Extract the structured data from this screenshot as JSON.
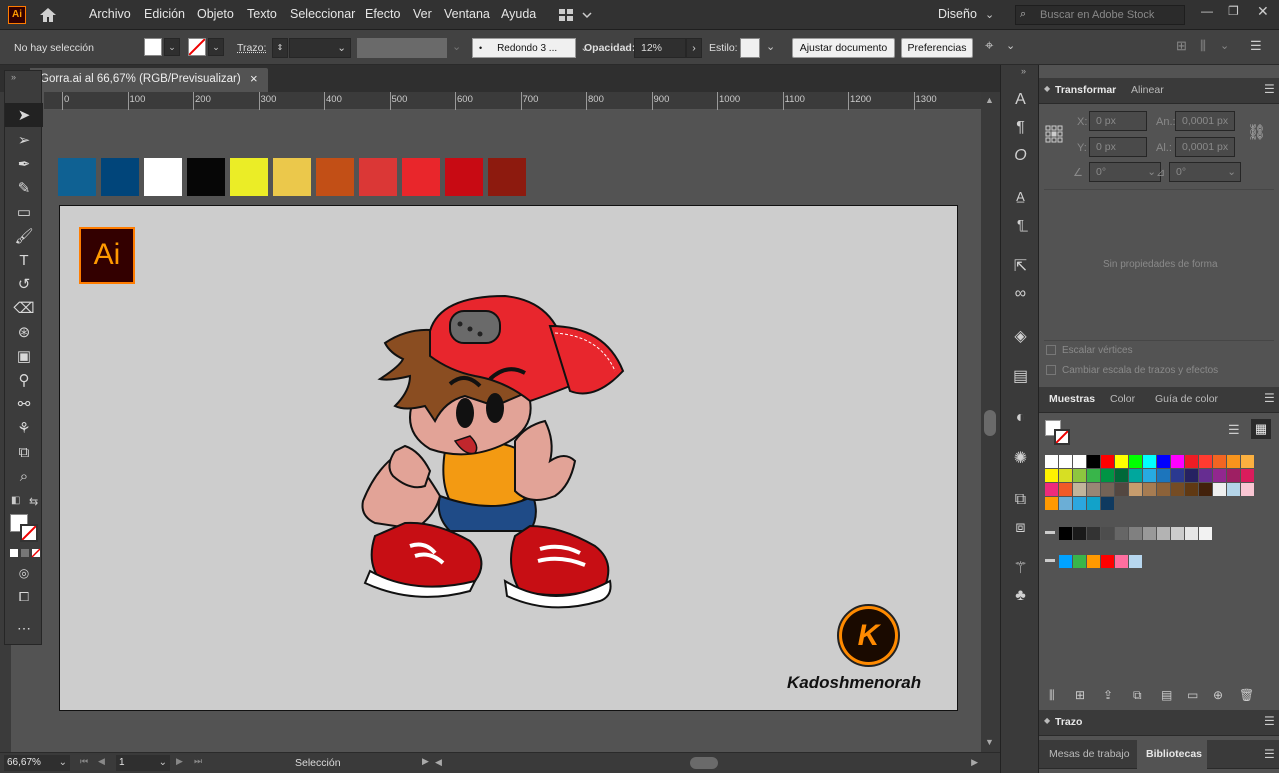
{
  "app": {
    "logo": "Ai"
  },
  "menu": {
    "items": [
      "Archivo",
      "Edición",
      "Objeto",
      "Texto",
      "Seleccionar",
      "Efecto",
      "Ver",
      "Ventana",
      "Ayuda"
    ],
    "workspace": "Diseño",
    "search_placeholder": "Buscar en Adobe Stock"
  },
  "control": {
    "selection": "No hay selección",
    "stroke_label": "Trazo:",
    "brush": "Redondo 3 ...",
    "opacity_label": "Opacidad:",
    "opacity_value": "12%",
    "style_label": "Estilo:",
    "adjust_button": "Ajustar documento",
    "prefs_button": "Preferencias"
  },
  "document": {
    "tab_title": "Gorra.ai al 66,67% (RGB/Previsualizar)",
    "close": "×"
  },
  "ruler": {
    "ticks": [
      "0",
      "100",
      "200",
      "300",
      "400",
      "500",
      "600",
      "700",
      "800",
      "900",
      "1000",
      "1100",
      "1200",
      "1300"
    ]
  },
  "swatch_row": {
    "colors": [
      "#0f6193",
      "#01457a",
      "#ffffff",
      "#060606",
      "#ebed26",
      "#ebc84b",
      "#c24f16",
      "#db3736",
      "#e9262b",
      "#c80a13",
      "#8d1a0e"
    ]
  },
  "artboard": {
    "ai_badge": "Ai",
    "watermark_letter": "K",
    "watermark_text": "Kadoshmenorah"
  },
  "status": {
    "zoom": "66,67%",
    "artboard_num": "1",
    "mode": "Selección"
  },
  "transform": {
    "tabs": [
      "Transformar",
      "Alinear"
    ],
    "x_label": "X:",
    "x_value": "0 px",
    "y_label": "Y:",
    "y_value": "0 px",
    "w_label": "An.:",
    "w_value": "0,0001 px",
    "h_label": "Al.:",
    "h_value": "0,0001 px",
    "rot_value": "0°",
    "shear_value": "0°",
    "no_props": "Sin propiedades de forma",
    "scale_corners": "Escalar vértices",
    "scale_strokes": "Cambiar escala de trazos y efectos"
  },
  "swatches_panel": {
    "tabs": [
      "Muestras",
      "Color",
      "Guía de color"
    ]
  },
  "stroke_panel": {
    "title": "Trazo"
  },
  "bottom_tabs": [
    "Mesas de trabajo",
    "Bibliotecas"
  ],
  "colors": {
    "accent_orange": "#ff7c00",
    "ai_brown": "#330000"
  }
}
